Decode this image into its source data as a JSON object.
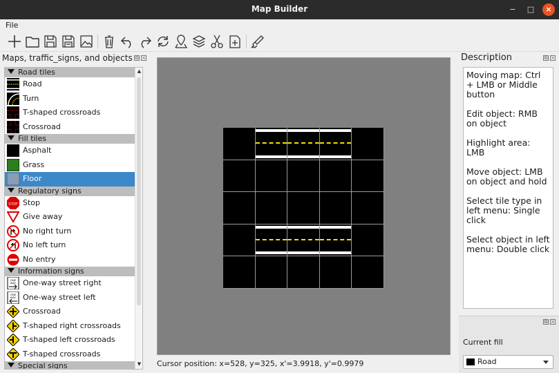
{
  "window": {
    "title": "Map Builder",
    "minimize": "−",
    "maximize": "□",
    "close": "×"
  },
  "menu": {
    "file": "File"
  },
  "toolbar": [
    "new-icon",
    "open-icon",
    "save-icon",
    "save-as-icon",
    "export-image-icon",
    "delete-icon",
    "undo-icon",
    "redo-icon",
    "rotate-icon",
    "marker-icon",
    "layers-icon",
    "cut-icon",
    "insert-icon",
    "brush-icon"
  ],
  "left_panel": {
    "title": "Maps, traffic_signs, and objects",
    "categories": [
      {
        "label": "Road tiles",
        "items": [
          {
            "label": "Road",
            "icon": "road-tile-icon"
          },
          {
            "label": "Turn",
            "icon": "turn-tile-icon"
          },
          {
            "label": "T-shaped crossroads",
            "icon": "t-crossroads-tile-icon"
          },
          {
            "label": "Crossroad",
            "icon": "crossroad-tile-icon"
          }
        ]
      },
      {
        "label": "Fill tiles",
        "items": [
          {
            "label": "Asphalt",
            "icon": "asphalt-tile-icon"
          },
          {
            "label": "Grass",
            "icon": "grass-tile-icon"
          },
          {
            "label": "Floor",
            "icon": "floor-tile-icon",
            "selected": true
          }
        ]
      },
      {
        "label": "Regulatory signs",
        "items": [
          {
            "label": "Stop",
            "icon": "stop-sign-icon"
          },
          {
            "label": "Give away",
            "icon": "give-way-sign-icon"
          },
          {
            "label": "No right turn",
            "icon": "no-right-turn-sign-icon"
          },
          {
            "label": "No left turn",
            "icon": "no-left-turn-sign-icon"
          },
          {
            "label": "No entry",
            "icon": "no-entry-sign-icon"
          }
        ]
      },
      {
        "label": "Information signs",
        "items": [
          {
            "label": "One-way street right",
            "icon": "one-way-right-sign-icon"
          },
          {
            "label": "One-way street left",
            "icon": "one-way-left-sign-icon"
          },
          {
            "label": "Crossroad",
            "icon": "crossroad-sign-icon"
          },
          {
            "label": "T-shaped right crossroads",
            "icon": "t-right-sign-icon"
          },
          {
            "label": "T-shaped left crossroads",
            "icon": "t-left-sign-icon"
          },
          {
            "label": "T-shaped crossroads",
            "icon": "t-sign-icon"
          }
        ]
      },
      {
        "label": "Special signs",
        "items": []
      }
    ]
  },
  "map": {
    "rows": [
      [
        "asphalt",
        "road",
        "road",
        "road",
        "asphalt"
      ],
      [
        "asphalt",
        "asphalt",
        "asphalt",
        "asphalt",
        "asphalt"
      ],
      [
        "asphalt",
        "asphalt",
        "asphalt",
        "asphalt",
        "asphalt"
      ],
      [
        "asphalt",
        "road",
        "road",
        "road",
        "asphalt"
      ],
      [
        "asphalt",
        "asphalt",
        "asphalt",
        "asphalt",
        "asphalt"
      ]
    ],
    "background": "#808080"
  },
  "status": {
    "cursor": "Cursor position: x=528, y=325, x'=3.9918, y'=0.9979"
  },
  "description": {
    "title": "Description",
    "lines": [
      "Moving map: Ctrl + LMB or Middle button",
      "Edit object: RMB on object",
      "Highlight area: LMB",
      "Move object: LMB on object and hold",
      "Select tile type in left menu: Single click",
      "Select object in left menu: Double click"
    ]
  },
  "fill": {
    "label": "Current fill",
    "value": "Road"
  },
  "colors": {
    "selection": "#3d88c8",
    "road_line": "#f5e000",
    "close_button": "#e95420"
  }
}
